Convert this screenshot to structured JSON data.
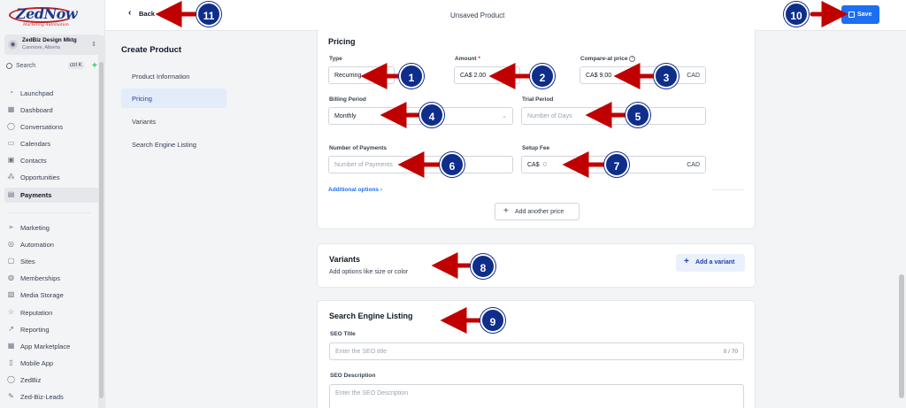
{
  "brand": {
    "name": "ZedNow",
    "tagline": "Marketing Automation"
  },
  "account": {
    "name": "ZedBiz Design Mktg",
    "location": "Canmore, Alberta"
  },
  "search": {
    "label": "Search",
    "shortcut": "ctrl K",
    "add": "+"
  },
  "sidebar": {
    "items": [
      {
        "label": "Launchpad",
        "icon": "rocket-icon"
      },
      {
        "label": "Dashboard",
        "icon": "grid-icon"
      },
      {
        "label": "Conversations",
        "icon": "chat-icon"
      },
      {
        "label": "Calendars",
        "icon": "calendar-icon"
      },
      {
        "label": "Contacts",
        "icon": "contacts-icon"
      },
      {
        "label": "Opportunities",
        "icon": "opportunities-icon"
      },
      {
        "label": "Payments",
        "icon": "payments-icon",
        "active": true
      },
      {
        "label": "Marketing",
        "icon": "send-icon"
      },
      {
        "label": "Automation",
        "icon": "automation-icon"
      },
      {
        "label": "Sites",
        "icon": "sites-icon"
      },
      {
        "label": "Memberships",
        "icon": "memberships-icon"
      },
      {
        "label": "Media Storage",
        "icon": "media-icon"
      },
      {
        "label": "Reputation",
        "icon": "star-icon"
      },
      {
        "label": "Reporting",
        "icon": "reporting-icon"
      },
      {
        "label": "App Marketplace",
        "icon": "marketplace-icon"
      },
      {
        "label": "Mobile App",
        "icon": "mobile-icon"
      },
      {
        "label": "ZedBiz",
        "icon": "zedbiz-icon"
      },
      {
        "label": "Zed-Biz-Leads",
        "icon": "wrench-icon"
      }
    ]
  },
  "topbar": {
    "back_label": "Back",
    "title": "Unsaved Product",
    "save_label": "Save"
  },
  "submenu": {
    "title": "Create Product",
    "items": [
      {
        "label": "Product Information"
      },
      {
        "label": "Pricing",
        "active": true
      },
      {
        "label": "Variants"
      },
      {
        "label": "Search Engine Listing"
      }
    ]
  },
  "pricing": {
    "title": "Pricing",
    "type_label": "Type",
    "type_value": "Recurring",
    "amount_label": "Amount",
    "amount_required": "*",
    "amount_value": "CA$ 2.00",
    "compare_label": "Compare-at price",
    "compare_info": "i",
    "compare_value": "CA$ 9.00",
    "compare_currency": "CAD",
    "billing_label": "Billing Period",
    "billing_value": "Monthly",
    "trial_label": "Trial Period",
    "trial_placeholder": "Number of Days",
    "payments_label": "Number of Payments",
    "payments_placeholder": "Number of Payments",
    "setup_label": "Setup Fee",
    "setup_prefix": "CA$",
    "setup_placeholder": "0",
    "setup_currency": "CAD",
    "additional_options": "Additional options ›",
    "add_price": "Add another price"
  },
  "variants": {
    "title": "Variants",
    "subtitle": "Add options like size or color",
    "add_button": "Add a variant"
  },
  "seo": {
    "title": "Search Engine Listing",
    "seo_title_label": "SEO Title",
    "seo_title_placeholder": "Enter the SEO title",
    "seo_title_counter": "0 / 70",
    "seo_desc_label": "SEO Description",
    "seo_desc_placeholder": "Enter the SEO Description"
  },
  "annotations": {
    "color_badge": "#0f2d8a",
    "color_arrow": "#c00000",
    "numbers": [
      "1",
      "2",
      "3",
      "4",
      "5",
      "6",
      "7",
      "8",
      "9",
      "10",
      "11"
    ]
  }
}
